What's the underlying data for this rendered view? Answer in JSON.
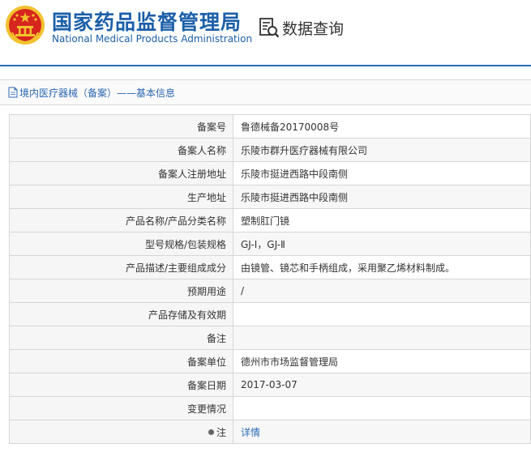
{
  "header": {
    "org_name_cn": "国家药品监督管理局",
    "org_name_en": "National Medical Products Administration",
    "query_label": "数据查询"
  },
  "section": {
    "title": "境内医疗器械（备案）——基本信息"
  },
  "rows": [
    {
      "label": "备案号",
      "value": "鲁德械备20170008号"
    },
    {
      "label": "备案人名称",
      "value": "乐陵市群升医疗器械有限公司"
    },
    {
      "label": "备案人注册地址",
      "value": "乐陵市挺进西路中段南侧"
    },
    {
      "label": "生产地址",
      "value": "乐陵市挺进西路中段南侧"
    },
    {
      "label": "产品名称/产品分类名称",
      "value": "塑制肛门镜"
    },
    {
      "label": "型号规格/包装规格",
      "value": "GJ-Ⅰ，GJ-Ⅱ"
    },
    {
      "label": "产品描述/主要组成成分",
      "value": "由镜管、镜芯和手柄组成，采用聚乙烯材料制成。"
    },
    {
      "label": "预期用途",
      "value": "/"
    },
    {
      "label": "产品存储及有效期",
      "value": ""
    },
    {
      "label": "备注",
      "value": ""
    },
    {
      "label": "备案单位",
      "value": "德州市市场监督管理局"
    },
    {
      "label": "备案日期",
      "value": "2017-03-07"
    },
    {
      "label": "变更情况",
      "value": ""
    }
  ],
  "note": {
    "label": "注",
    "link_text": "详情"
  },
  "colors": {
    "brand_blue": "#1b5fa8",
    "link_blue": "#2b6cb5",
    "emblem_red": "#d7261e",
    "emblem_gold": "#f2c22e"
  },
  "icons": {
    "emblem": "national-emblem-icon",
    "query": "document-search-icon",
    "section": "document-icon",
    "note": "bullet-icon"
  }
}
